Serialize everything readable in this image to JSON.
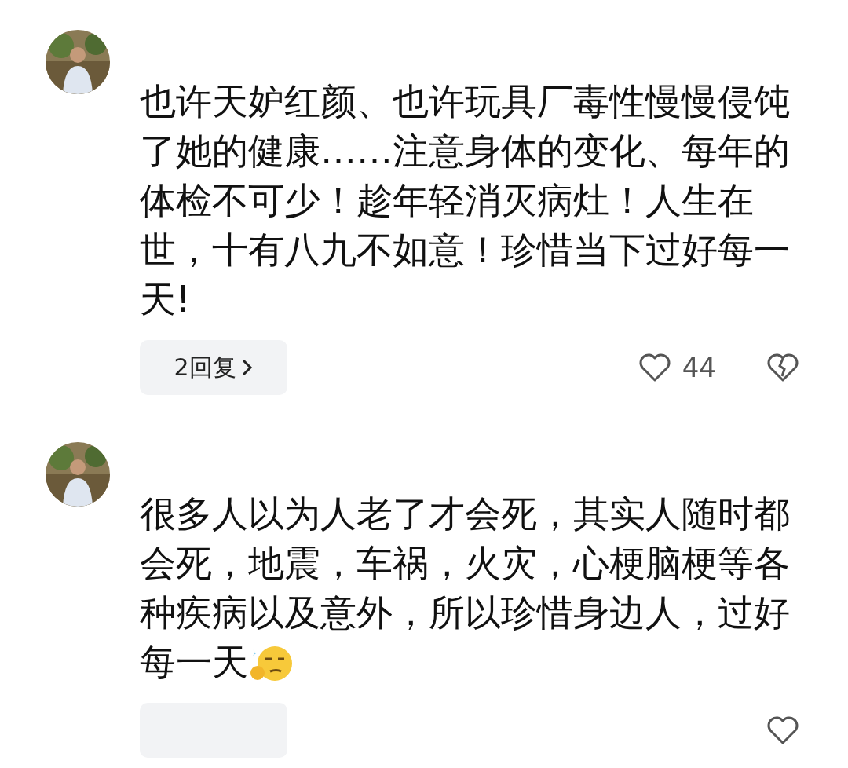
{
  "comments": [
    {
      "text": "也许天妒红颜、也许玩具厂毒性慢慢侵饨了她的健康……注意身体的变化、每年的体检不可少！趁年轻消灭病灶！人生在世，十有八九不如意！珍惜当下过好每一天!",
      "replies": "2回复",
      "likes": "44",
      "dislike": true
    },
    {
      "text": "很多人以为人老了才会死，其实人随时都会死，地震，车祸，火灾，心梗脑梗等各种疾病以及意外，所以珍惜身边人，过好每一天",
      "emoji": true
    }
  ]
}
